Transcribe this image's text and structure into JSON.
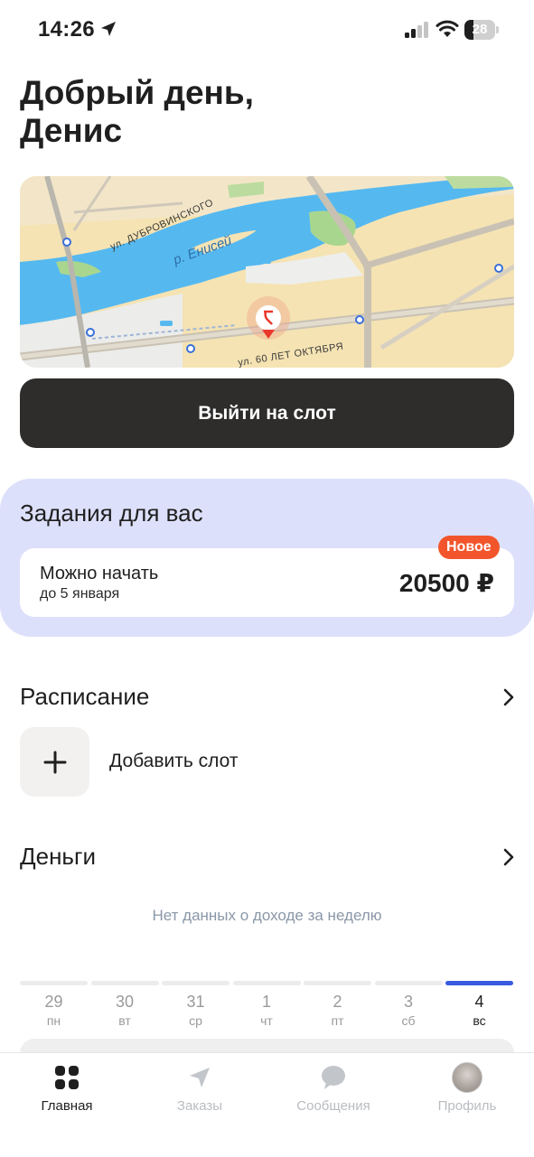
{
  "status_bar": {
    "time": "14:26",
    "battery": "28",
    "battery_level": 0.28
  },
  "greeting": {
    "line1": "Добрый день,",
    "line2": "Денис"
  },
  "map": {
    "labels": {
      "street_top": "ул. ДУБРОВИНСКОГО",
      "river": "р. Енисей",
      "street_bottom": "ул. 60 ЛЕТ ОКТЯБРЯ"
    },
    "colors": {
      "water": "#55b9f0",
      "land": "#f5e3b3",
      "green": "#a9d68f",
      "road": "#c9c2b4",
      "pin": "#e9382b"
    }
  },
  "actions": {
    "go_to_slot": "Выйти на слот"
  },
  "tasks": {
    "title": "Задания для вас",
    "card": {
      "title": "Можно начать",
      "subtitle": "до 5 января",
      "amount": "20500 ₽",
      "badge": "Новое"
    }
  },
  "schedule": {
    "title": "Расписание",
    "add_slot": "Добавить слот"
  },
  "money": {
    "title": "Деньги",
    "empty": "Нет данных о доходе за неделю",
    "days": [
      {
        "num": "29",
        "wd": "пн"
      },
      {
        "num": "30",
        "wd": "вт"
      },
      {
        "num": "31",
        "wd": "ср"
      },
      {
        "num": "1",
        "wd": "чт"
      },
      {
        "num": "2",
        "wd": "пт"
      },
      {
        "num": "3",
        "wd": "сб"
      },
      {
        "num": "4",
        "wd": "вс"
      }
    ],
    "active_day_index": 6
  },
  "tabbar": {
    "items": [
      {
        "label": "Главная",
        "icon": "home-grid-icon"
      },
      {
        "label": "Заказы",
        "icon": "navigation-arrow-icon"
      },
      {
        "label": "Сообщения",
        "icon": "chat-bubble-icon"
      },
      {
        "label": "Профиль",
        "icon": "avatar"
      }
    ],
    "active_index": 0
  },
  "colors": {
    "accent_blue": "#3a5be0",
    "badge_red": "#f2552c",
    "tasks_bg": "#dde0fa",
    "dark_button": "#2e2d2c"
  }
}
